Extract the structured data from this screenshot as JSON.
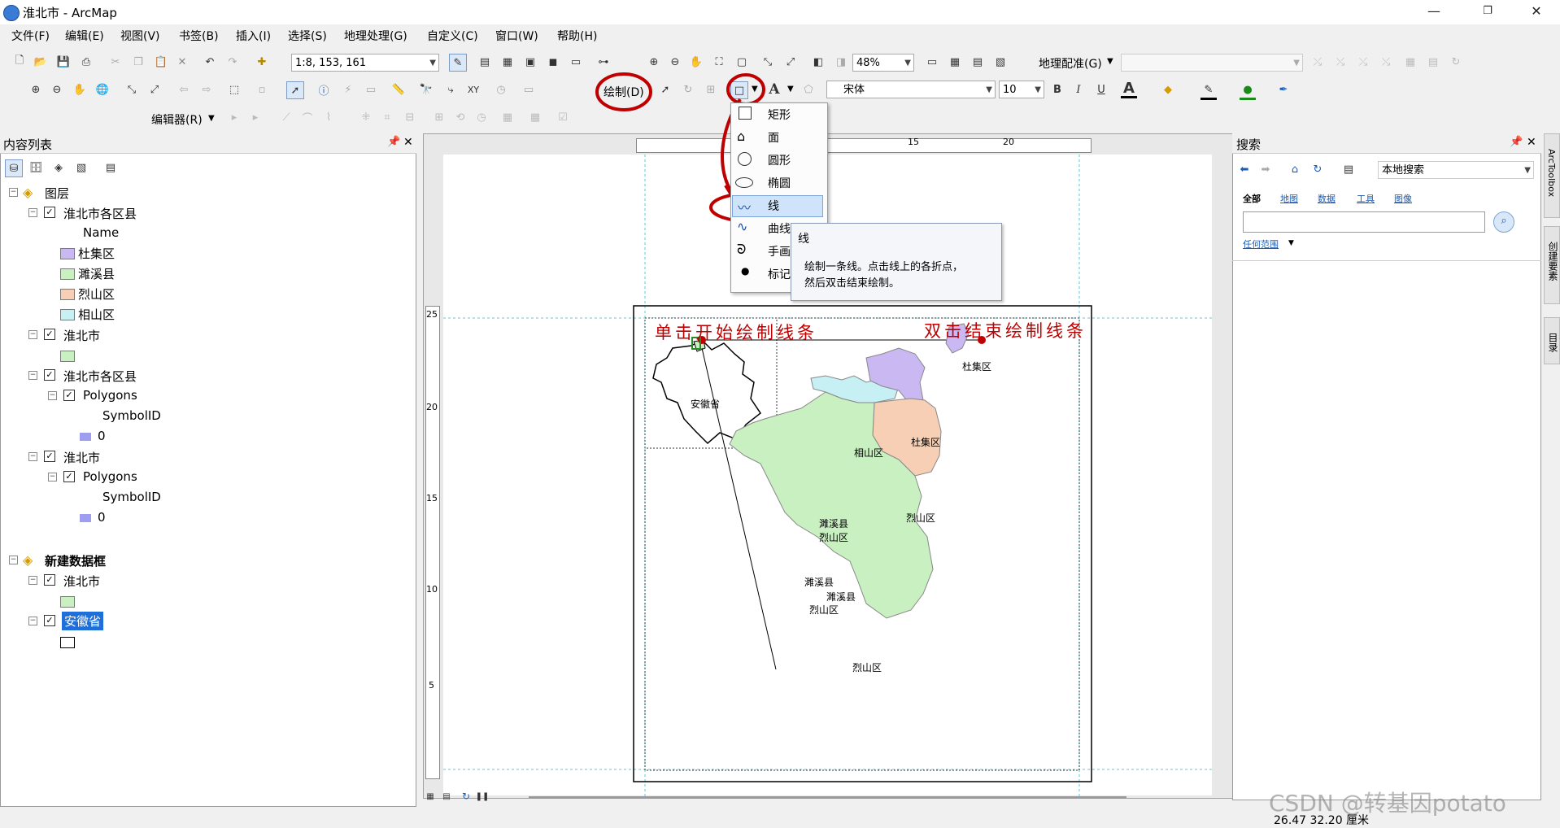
{
  "window": {
    "title": "淮北市 - ArcMap",
    "minimize": "—",
    "maximize": "❐",
    "close": "✕"
  },
  "menu": [
    "文件(F)",
    "编辑(E)",
    "视图(V)",
    "书签(B)",
    "插入(I)",
    "选择(S)",
    "地理处理(G)",
    "自定义(C)",
    "窗口(W)",
    "帮助(H)"
  ],
  "toolbar": {
    "scale_value": "1:8, 153, 161",
    "zoom_value": "48%",
    "georef_label": "地理配准(G)",
    "draw_label": "绘制(D)",
    "font_name": "宋体",
    "font_size": "10",
    "bold": "B",
    "italic": "I",
    "underline": "U",
    "editor_label": "编辑器(R)"
  },
  "toc": {
    "title": "内容列表",
    "pin": "ᵖ",
    "close": "✕",
    "frame1": "图层",
    "layer1": "淮北市各区县",
    "field_name": "Name",
    "classes": [
      {
        "label": "杜集区",
        "color": "#c9b8f2"
      },
      {
        "label": "濉溪县",
        "color": "#c8f0c0"
      },
      {
        "label": "烈山区",
        "color": "#f6cfb4"
      },
      {
        "label": "相山区",
        "color": "#c6f0f4"
      }
    ],
    "layer2": "淮北市",
    "layer2_color": "#c8f0c0",
    "layer3": "淮北市各区县",
    "polygons": "Polygons",
    "symbolid": "SymbolID",
    "value_zero": "0",
    "poly_color": "#9e9ef0",
    "layer4": "淮北市",
    "frame2": "新建数据框",
    "layer5": "淮北市",
    "layer6": "安徽省"
  },
  "draw_menu": {
    "items": [
      {
        "label": "矩形",
        "icon": "rectangle-icon"
      },
      {
        "label": "面",
        "icon": "polygon-icon"
      },
      {
        "label": "圆形",
        "icon": "circle-icon"
      },
      {
        "label": "椭圆",
        "icon": "ellipse-icon"
      },
      {
        "label": "线",
        "icon": "line-icon"
      },
      {
        "label": "曲线",
        "icon": "curve-icon"
      },
      {
        "label": "手画",
        "icon": "freehand-icon"
      },
      {
        "label": "标记",
        "icon": "marker-icon"
      }
    ],
    "tooltip_title": "线",
    "tooltip_body_1": "绘制一条线。点击线上的各折点，",
    "tooltip_body_2": "然后双击结束绘制。"
  },
  "annotations": {
    "start": "单击开始绘制线条",
    "end": "双击结束绘制线条"
  },
  "map_labels": {
    "anhui": "安徽省",
    "duji": "杜集区",
    "duji_small": "杜集区",
    "xiangshan": "相山区",
    "lieshan": "烈山区",
    "suixi_a": "濉溪县",
    "lieshan_a": "烈山区",
    "suixi_b": "濉溪县",
    "suixi_c": "濉溪县",
    "lieshan_b": "烈山区",
    "lieshan_c": "烈山区"
  },
  "ruler": {
    "h_ticks": [
      "15",
      "20"
    ],
    "v_ticks": [
      "25",
      "20",
      "15",
      "10",
      "5"
    ]
  },
  "search": {
    "title": "搜索",
    "scope": "本地搜索",
    "tabs": [
      "全部",
      "地图",
      "数据",
      "工具",
      "图像"
    ],
    "extent_link": "任何范围"
  },
  "side_tabs": [
    "ArcToolbox",
    "创建要素",
    "目录"
  ],
  "status": {
    "coords": "26.47  32.20 厘米",
    "watermark": "CSDN @转基因potato"
  },
  "colors": {
    "suixi": "#c8f0c0",
    "lieshan": "#f6cfb4",
    "xiangshan": "#c6f0f4",
    "duji": "#c9b8f2",
    "annotation_red": "#c00000",
    "selection_blue": "#1e6fd9"
  }
}
